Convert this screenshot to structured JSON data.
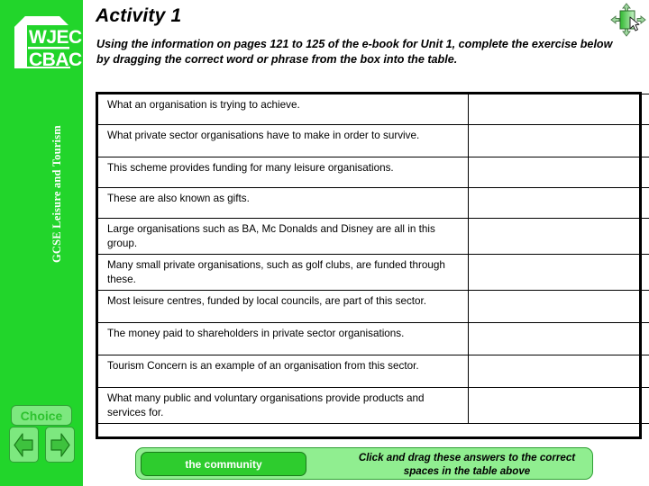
{
  "sidebar": {
    "logo": {
      "line1": "WJEC",
      "line2": "CBAC",
      "icon": "wjec-cbac-logo"
    },
    "vertical_title": "GCSE Leisure and Tourism",
    "choice_label": "Choice",
    "back_icon": "arrow-left-icon",
    "next_icon": "arrow-right-icon",
    "bg_color": "#22d52b"
  },
  "header": {
    "title": "Activity 1",
    "intro": "Using the information on pages 121 to 125 of the e-book for Unit 1, complete the exercise below by dragging the correct word or phrase from the box into the table.",
    "drag_icon": "drag-and-drop-cursor-icon"
  },
  "table": {
    "rows": [
      {
        "definition": "What an organisation is trying to achieve.",
        "answer": "",
        "lines": 1
      },
      {
        "definition": "What private sector organisations have to make in order to survive.",
        "answer": "",
        "lines": 2
      },
      {
        "definition": "This scheme provides funding for many leisure organisations.",
        "answer": "",
        "lines": 1
      },
      {
        "definition": "These are also known as gifts.",
        "answer": "",
        "lines": 1
      },
      {
        "definition": "Large organisations such as BA, Mc Donalds and Disney are all in this group.",
        "answer": "",
        "lines": 2
      },
      {
        "definition": "Many small private organisations, such as golf clubs, are funded through these.",
        "answer": "",
        "lines": 2
      },
      {
        "definition": "Most leisure centres, funded by local councils, are part of this sector.",
        "answer": "",
        "lines": 2
      },
      {
        "definition": "The money paid to shareholders in private sector organisations.",
        "answer": "",
        "lines": 2
      },
      {
        "definition": "Tourism Concern is an example of an organisation from this sector.",
        "answer": "",
        "lines": 2
      },
      {
        "definition": "What many public and voluntary organisations provide products and services for.",
        "answer": "",
        "lines": 2
      }
    ]
  },
  "answer_bank": {
    "chips": [
      "the community"
    ],
    "note": "Click and drag these answers to the correct spaces in the table above",
    "chip_color": "#2ecc2e",
    "bank_color": "#90ee90"
  }
}
